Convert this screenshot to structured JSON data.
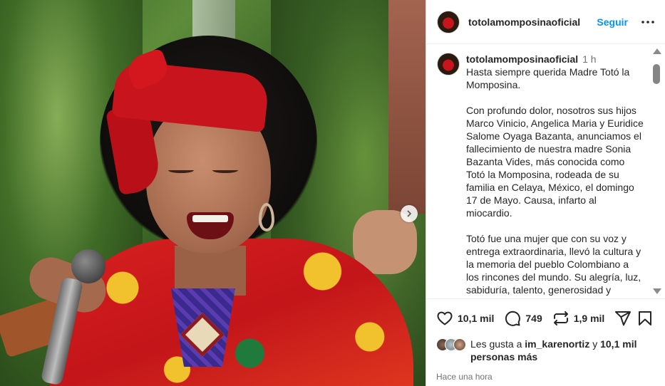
{
  "colors": {
    "accent": "#0095f6",
    "text": "#262626",
    "muted": "#737373"
  },
  "header": {
    "username": "totolamomposinaoficial",
    "follow_label": "Seguir",
    "more_icon": "more-horizontal-icon"
  },
  "caption": {
    "username": "totolamomposinaoficial",
    "time": "1 h",
    "paragraphs": [
      "Hasta siempre querida Madre Totó la Momposina.",
      "Con profundo dolor, nosotros sus hijos Marco Vinicio, Angelica Maria y Euridice Salome Oyaga Bazanta, anunciamos el fallecimiento de nuestra madre Sonia Bazanta Vides, más conocida como Totó la Momposina, rodeada de su familia en Celaya, México, el domingo 17 de Mayo. Causa, infarto al miocardio.",
      "Totó fue una mujer que con su voz y entrega extraordinaria, llevó la cultura y la memoria del pueblo Colombiano a los rincones del mundo. Su alegría, luz, sabiduría, talento, generosidad y"
    ]
  },
  "actions": {
    "likes_count": "10,1 mil",
    "comments_count": "749",
    "reposts_count": "1,9 mil",
    "icons": [
      "heart-icon",
      "comment-icon",
      "repost-icon",
      "share-icon",
      "bookmark-icon"
    ]
  },
  "likes": {
    "prefix": "Les gusta a ",
    "user": "im_karenortiz",
    "middle": " y ",
    "others": "10,1 mil",
    "others_line2": "personas más"
  },
  "posted": "Hace una hora"
}
